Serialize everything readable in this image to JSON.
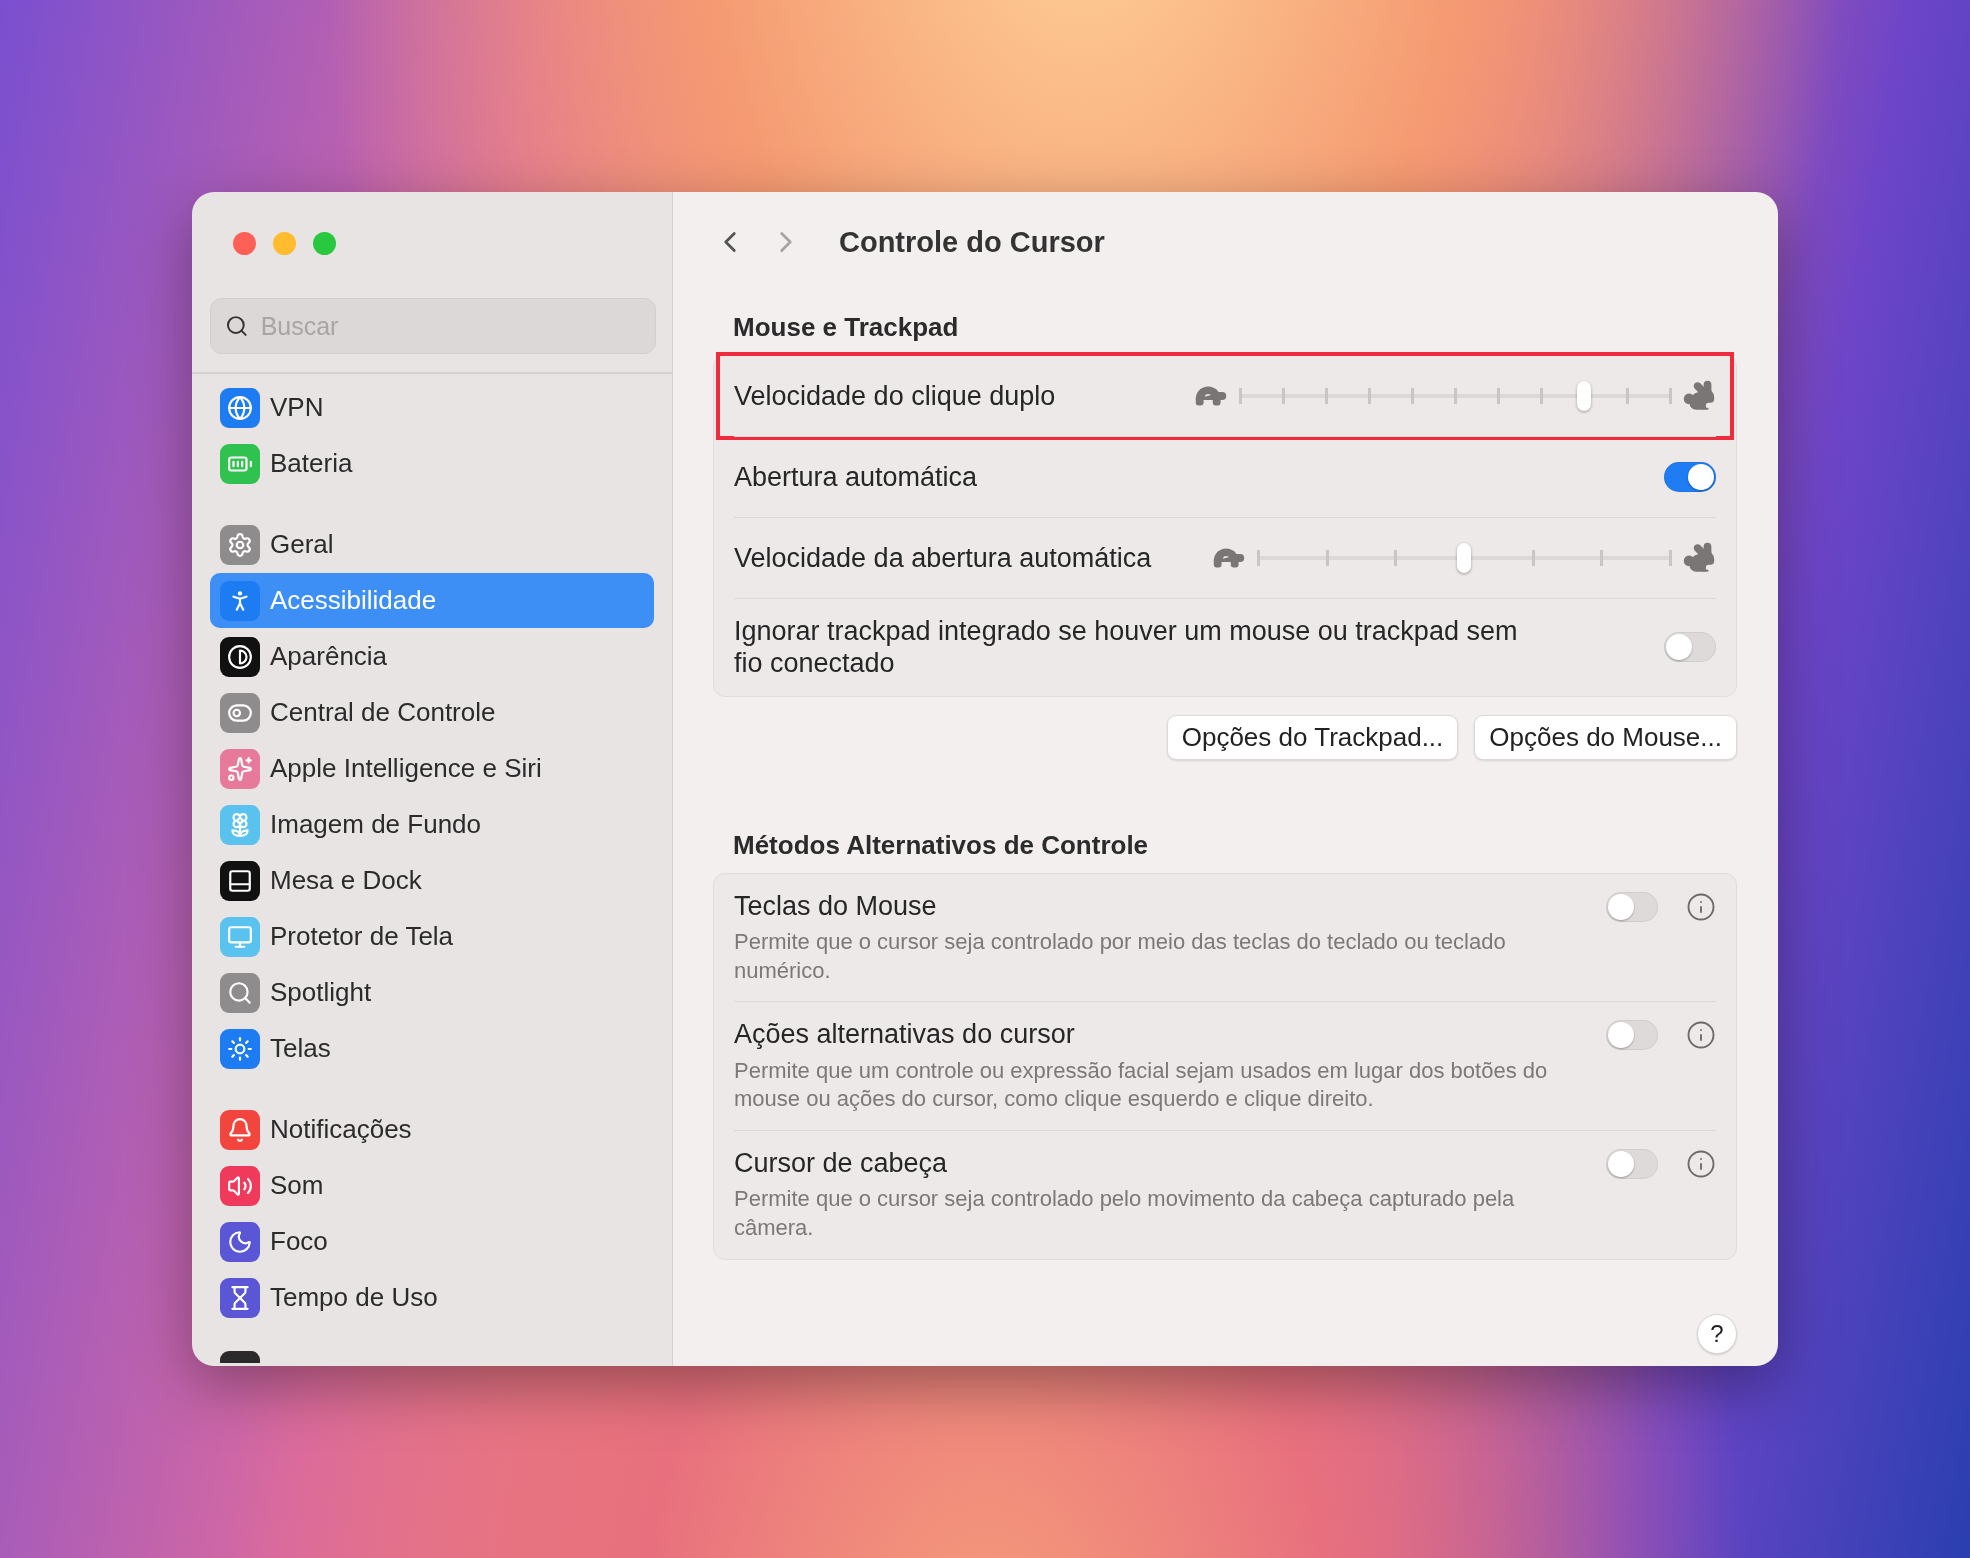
{
  "window": {
    "title": "Controle do Cursor"
  },
  "sidebar": {
    "search": {
      "placeholder": "Buscar"
    },
    "groups": [
      [
        {
          "label": "VPN",
          "selected": false
        },
        {
          "label": "Bateria",
          "selected": false
        }
      ],
      [
        {
          "label": "Geral",
          "selected": false
        },
        {
          "label": "Acessibilidade",
          "selected": true
        },
        {
          "label": "Aparência",
          "selected": false
        },
        {
          "label": "Central de Controle",
          "selected": false
        },
        {
          "label": "Apple Intelligence e Siri",
          "selected": false
        },
        {
          "label": "Imagem de Fundo",
          "selected": false
        },
        {
          "label": "Mesa e Dock",
          "selected": false
        },
        {
          "label": "Protetor de Tela",
          "selected": false
        },
        {
          "label": "Spotlight",
          "selected": false
        },
        {
          "label": "Telas",
          "selected": false
        }
      ],
      [
        {
          "label": "Notificações",
          "selected": false
        },
        {
          "label": "Som",
          "selected": false
        },
        {
          "label": "Foco",
          "selected": false
        },
        {
          "label": "Tempo de Uso",
          "selected": false
        }
      ]
    ]
  },
  "sections": [
    {
      "title": "Mouse e Trackpad",
      "rows": [
        {
          "kind": "slider",
          "label": "Velocidade do clique duplo",
          "level": 0.8,
          "highlighted": true
        },
        {
          "kind": "toggle",
          "label": "Abertura automática",
          "on": true
        },
        {
          "kind": "slider",
          "label": "Velocidade da abertura automática",
          "level": 0.5
        },
        {
          "kind": "toggle",
          "label": "Ignorar trackpad integrado se houver um mouse ou trackpad sem fio conectado",
          "on": false
        }
      ],
      "buttons": [
        "Opções do Trackpad...",
        "Opções do Mouse..."
      ]
    },
    {
      "title": "Métodos Alternativos de Controle",
      "rows": [
        {
          "kind": "info-toggle",
          "label": "Teclas do Mouse",
          "description": "Permite que o cursor seja controlado por meio das teclas do teclado ou teclado numérico.",
          "on": false
        },
        {
          "kind": "info-toggle",
          "label": "Ações alternativas do cursor",
          "description": "Permite que um controle ou expressão facial sejam usados em lugar dos botões do mouse ou ações do cursor, como clique esquerdo e clique direito.",
          "on": false
        },
        {
          "kind": "info-toggle",
          "label": "Cursor de cabeça",
          "description": "Permite que o cursor seja controlado pelo movimento da cabeça capturado pela câmera.",
          "on": false
        }
      ]
    }
  ],
  "help_button": "?"
}
